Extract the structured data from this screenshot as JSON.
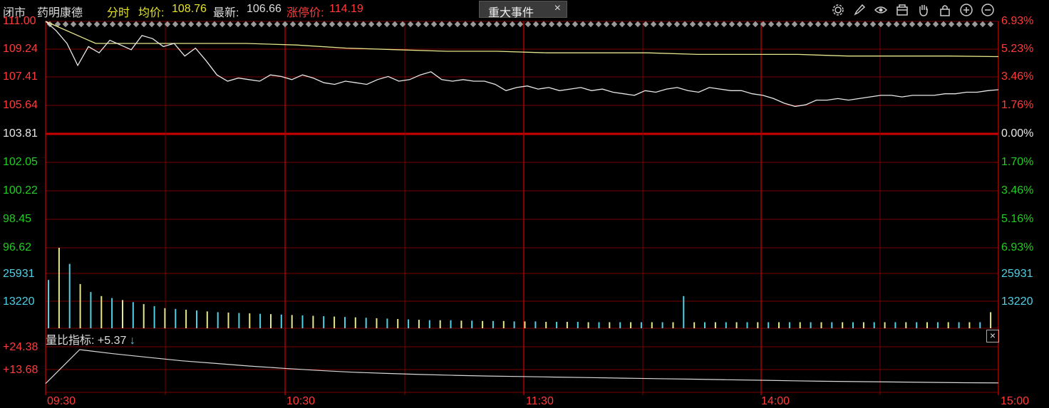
{
  "header": {
    "status": "闭市",
    "stock_name": "药明康德",
    "mode": "分时",
    "avg_label": "均价:",
    "avg_value": "108.76",
    "latest_label": "最新:",
    "latest_value": "106.66",
    "limit_label": "涨停价:",
    "limit_value": "114.19",
    "event_tab": "重大事件",
    "event_close": "×"
  },
  "tools": [
    "settings-icon",
    "pen-icon",
    "eye-icon",
    "box-icon",
    "hand-icon",
    "lock-icon",
    "zoom-in-icon",
    "zoom-out-icon"
  ],
  "price_axis": {
    "left": [
      "111.00",
      "109.24",
      "107.41",
      "105.64",
      "103.81",
      "102.05",
      "100.22",
      "98.45",
      "96.62"
    ],
    "right": [
      "6.93%",
      "5.23%",
      "3.46%",
      "1.76%",
      "0.00%",
      "1.70%",
      "3.46%",
      "5.16%",
      "6.93%"
    ]
  },
  "volume_axis": {
    "left": [
      "25931",
      "13220"
    ],
    "right": [
      "25931",
      "13220"
    ]
  },
  "volume_ratio": {
    "label": "量比指标:",
    "value": "+5.37",
    "arrow": "↓",
    "close": "×",
    "axis": [
      "+24.38",
      "+13.68"
    ]
  },
  "time_axis": [
    "09:30",
    "10:30",
    "11:30",
    "14:00",
    "15:00"
  ],
  "colors": {
    "up": "#ff3b3b",
    "down": "#22cc22",
    "grid": "#7a0000",
    "price_line": "#e8e8e8",
    "avg_line": "#e6e68a",
    "vol_up": "#4fd0e6",
    "vol_down": "#e6e68a"
  },
  "chart_data": {
    "type": "line",
    "prev_close": 103.81,
    "ylim": [
      96.62,
      111.0
    ],
    "x": [
      "09:30",
      "10:30",
      "11:30",
      "14:00",
      "15:00"
    ],
    "series": [
      {
        "values": [
          111.0,
          110.4,
          109.6,
          108.2,
          109.4,
          109.0,
          109.8,
          109.5,
          109.2,
          110.1,
          109.9,
          109.4,
          109.6,
          108.8,
          109.3,
          108.5,
          107.6,
          107.2,
          107.4,
          107.3,
          107.2,
          107.6,
          107.5,
          107.3,
          107.6,
          107.4,
          107.1,
          107.0,
          107.2,
          107.1,
          107.0,
          107.3,
          107.5,
          107.2,
          107.3,
          107.6,
          107.8,
          107.3,
          107.2,
          107.3,
          107.2,
          107.2,
          107.0,
          106.6,
          106.8,
          106.9,
          106.7,
          106.8,
          106.6,
          106.7,
          106.8,
          106.6,
          106.7,
          106.5,
          106.4,
          106.3,
          106.6,
          106.5,
          106.7,
          106.8,
          106.6,
          106.5,
          106.8,
          106.7,
          106.6,
          106.6,
          106.4,
          106.3,
          106.1,
          105.8,
          105.6,
          105.7,
          106.0,
          106.0,
          106.1,
          106.0,
          106.1,
          106.2,
          106.3,
          106.3,
          106.2,
          106.3,
          106.3,
          106.3,
          106.4,
          106.4,
          106.5,
          106.5,
          106.6,
          106.66
        ]
      },
      {
        "values": [
          111.0,
          109.6,
          109.6,
          109.6,
          109.6,
          109.5,
          109.3,
          109.2,
          109.1,
          109.1,
          109.0,
          109.0,
          109.0,
          108.9,
          108.9,
          108.9,
          108.8,
          108.8,
          108.8,
          108.76
        ]
      }
    ],
    "volume": [
      12000,
      20000,
      16000,
      11000,
      9000,
      8000,
      7500,
      7000,
      6500,
      6000,
      5500,
      5000,
      4800,
      4600,
      4400,
      4200,
      4000,
      3900,
      3800,
      3700,
      3600,
      3500,
      3400,
      3300,
      3200,
      3100,
      3000,
      2900,
      2800,
      2700,
      2600,
      2500,
      2400,
      2300,
      2200,
      2100,
      2000,
      2000,
      2000,
      1900,
      1900,
      1800,
      1800,
      1800,
      1700,
      1700,
      1700,
      1600,
      1600,
      1600,
      1600,
      1500,
      1500,
      1500,
      1500,
      1500,
      1500,
      1500,
      1500,
      1500,
      8000,
      1500,
      1500,
      1500,
      1500,
      1500,
      1500,
      1500,
      1500,
      1500,
      1500,
      1500,
      1500,
      1500,
      1500,
      1500,
      1500,
      1500,
      1500,
      1500,
      1500,
      1500,
      1500,
      1500,
      1500,
      1500,
      1500,
      1500,
      1500,
      4000
    ],
    "volume_ratio_values": [
      5,
      24.38,
      22,
      20,
      18,
      16.5,
      15,
      13.68,
      12.5,
      11.5,
      10.8,
      10.2,
      9.7,
      9.3,
      9.0,
      8.7,
      8.4,
      8.1,
      7.8,
      7.5,
      7.2,
      6.9,
      6.6,
      6.3,
      6.1,
      5.9,
      5.7,
      5.5,
      5.37
    ]
  }
}
